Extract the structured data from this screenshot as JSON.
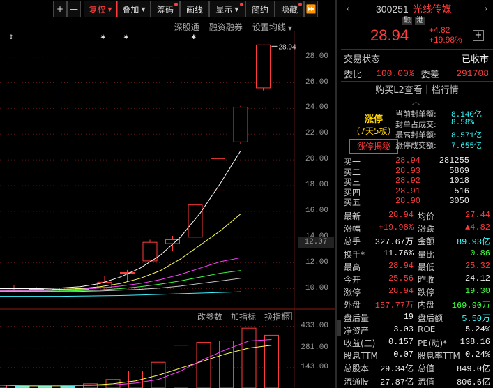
{
  "toolbar": {
    "plus": "+",
    "minus": "—",
    "fuquan": "复权",
    "diejia": "叠加",
    "chouma": "筹码",
    "huaxian": "画线",
    "xianshi": "显示",
    "jianyue": "简约",
    "yincang": "隐藏",
    "expand": "⏩"
  },
  "sublinks": [
    "深股通",
    "融资融券",
    "设置均线"
  ],
  "chart": {
    "y_ticks": [
      "28.00",
      "26.00",
      "24.00",
      "22.00",
      "20.00",
      "18.00",
      "16.00",
      "14.00",
      "12.00",
      "10.00"
    ],
    "current_price_tag": "12.07",
    "high_marker": "28.94",
    "vol_ticks": [
      "433.00",
      "281.00",
      "143.00"
    ],
    "vol_tools": [
      "改参数",
      "加指标",
      "换指标"
    ],
    "vol_close": "✕"
  },
  "chart_data": {
    "type": "candlestick",
    "y_range": [
      9,
      29.5
    ],
    "candles": [
      {
        "o": 9.9,
        "h": 10.3,
        "l": 9.75,
        "c": 9.9,
        "color": "red"
      },
      {
        "o": 9.9,
        "h": 10.1,
        "l": 9.8,
        "c": 9.95,
        "color": "cyan"
      },
      {
        "o": 9.95,
        "h": 10.05,
        "l": 9.85,
        "c": 9.95,
        "color": "cyan"
      },
      {
        "o": 10.0,
        "h": 10.1,
        "l": 9.8,
        "c": 9.9,
        "color": "cyan"
      },
      {
        "o": 10.1,
        "h": 11.0,
        "l": 9.9,
        "c": 10.5,
        "color": "red"
      },
      {
        "o": 11.25,
        "h": 11.45,
        "l": 10.55,
        "c": 11.2,
        "color": "red"
      },
      {
        "o": 12.15,
        "h": 13.8,
        "l": 12.1,
        "c": 13.6,
        "color": "red"
      },
      {
        "o": 13.5,
        "h": 14.1,
        "l": 12.9,
        "c": 13.8,
        "color": "red"
      },
      {
        "o": 14.0,
        "h": 16.5,
        "l": 14.0,
        "c": 16.5,
        "color": "red"
      },
      {
        "o": 17.6,
        "h": 20.15,
        "l": 17.5,
        "c": 20.1,
        "color": "red"
      },
      {
        "o": 21.4,
        "h": 24.2,
        "l": 21.2,
        "c": 24.1,
        "color": "red"
      },
      {
        "o": 25.6,
        "h": 28.94,
        "l": 25.4,
        "c": 28.94,
        "color": "red"
      }
    ],
    "ma_lines": [
      {
        "color": "#ffffff",
        "values": [
          10.0,
          10.0,
          10.0,
          10.05,
          10.15,
          10.4,
          10.9,
          11.6,
          12.6,
          14.0,
          15.9,
          18.2,
          20.7
        ]
      },
      {
        "color": "#ffff55",
        "values": [
          9.9,
          9.9,
          9.9,
          9.95,
          10.0,
          10.15,
          10.4,
          10.8,
          11.4,
          12.3,
          13.4,
          14.5,
          15.8
        ]
      },
      {
        "color": "#ff44ff",
        "values": [
          9.85,
          9.85,
          9.85,
          9.9,
          9.95,
          10.05,
          10.2,
          10.4,
          10.7,
          11.1,
          11.6,
          12.1,
          12.4
        ]
      },
      {
        "color": "#44ff44",
        "values": [
          9.8,
          9.8,
          9.8,
          9.82,
          9.85,
          9.9,
          10.0,
          10.15,
          10.35,
          10.6,
          10.9,
          11.2,
          11.4
        ]
      },
      {
        "color": "#cccccc",
        "values": [
          9.75,
          9.75,
          9.75,
          9.76,
          9.78,
          9.82,
          9.88,
          9.95,
          10.05,
          10.2,
          10.4,
          10.6,
          10.8
        ]
      },
      {
        "color": "#3ff3ff",
        "values": [
          9.4,
          9.4,
          9.4,
          9.4,
          9.42,
          9.44,
          9.46,
          9.5,
          9.55,
          9.6,
          9.65,
          9.7,
          9.75
        ]
      }
    ],
    "volume": [
      20,
      15,
      14,
      18,
      30,
      60,
      120,
      180,
      300,
      320,
      330,
      420,
      370
    ],
    "volume_colors": [
      "red",
      "cyan",
      "cyan",
      "cyan",
      "red",
      "red",
      "red",
      "red",
      "red",
      "red",
      "red",
      "red",
      "red"
    ],
    "volume_range": [
      0,
      460
    ],
    "vol_ma": [
      [
        20,
        15,
        15,
        16,
        20,
        30,
        50,
        90,
        140,
        190,
        240,
        280,
        300
      ],
      [
        20,
        18,
        17,
        17,
        18,
        22,
        35,
        60,
        120,
        200,
        270,
        330,
        340
      ]
    ]
  },
  "panel": {
    "code": "300251",
    "name": "光线传媒",
    "badge1": "融",
    "badge2": "港",
    "price": "28.94",
    "chg": "+4.82",
    "chg_pct": "+19.98%",
    "plus": "+",
    "trade_status_label": "交易状态",
    "trade_status_value": "已收市",
    "weibi_label": "委比",
    "weibi_value": "100.00%",
    "weicha_label": "委差",
    "weicha_value": "291708",
    "l2_link": "购买L2查看十档行情",
    "collapse_caret": "︿",
    "zt_title": "涨停",
    "zt_sub": "（7天5板）",
    "zt_btn": "涨停揭秘",
    "zt_info": [
      {
        "k": "当前封单额:",
        "v": "8.140亿"
      },
      {
        "k": "封单占成交:",
        "v": "8.58%"
      },
      {
        "k": "最高封单额:",
        "v": "8.571亿"
      },
      {
        "k": "涨停成交额:",
        "v": "7.655亿"
      }
    ],
    "bids": [
      {
        "k": "买一",
        "p": "28.94",
        "v": "281255"
      },
      {
        "k": "买二",
        "p": "28.93",
        "v": "5869"
      },
      {
        "k": "买三",
        "p": "28.92",
        "v": "1018"
      },
      {
        "k": "买四",
        "p": "28.91",
        "v": "516"
      },
      {
        "k": "买五",
        "p": "28.90",
        "v": "3050"
      }
    ],
    "quotes": [
      {
        "l1": "最新",
        "v1": "28.94",
        "c1": "red",
        "l2": "均价",
        "v2": "27.44",
        "c2": "red"
      },
      {
        "l1": "涨幅",
        "v1": "+19.98%",
        "c1": "red",
        "l2": "涨跌",
        "v2": "▲4.82",
        "c2": "red"
      },
      {
        "l1": "总手",
        "v1": "327.67万",
        "c1": "white",
        "l2": "金额",
        "v2": "89.93亿",
        "c2": "cyan"
      },
      {
        "l1": "换手*",
        "v1": "11.76%",
        "c1": "white",
        "l2": "量比",
        "v2": "0.86",
        "c2": "green"
      },
      {
        "l1": "最高",
        "v1": "28.94",
        "c1": "red",
        "l2": "最低",
        "v2": "25.32",
        "c2": "red"
      },
      {
        "l1": "今开",
        "v1": "25.56",
        "c1": "red",
        "l2": "昨收",
        "v2": "24.12",
        "c2": "white"
      },
      {
        "l1": "涨停",
        "v1": "28.94",
        "c1": "red",
        "l2": "跌停",
        "v2": "19.30",
        "c2": "green"
      },
      {
        "l1": "外盘",
        "v1": "157.77万",
        "c1": "red",
        "l2": "内盘",
        "v2": "169.90万",
        "c2": "green"
      },
      {
        "l1": "盘后量",
        "v1": "19",
        "c1": "white",
        "l2": "盘后额",
        "v2": "5.50万",
        "c2": "cyan"
      },
      {
        "l1": "净资产",
        "v1": "3.03",
        "c1": "white",
        "l2": "ROE",
        "v2": "5.24%",
        "c2": "white"
      },
      {
        "l1": "收益(三)",
        "v1": "0.157",
        "c1": "white",
        "l2": "PE(动)*",
        "v2": "138.16",
        "c2": "white"
      },
      {
        "l1": "股息TTM",
        "v1": "0.07",
        "c1": "white",
        "l2": "股息率TTM",
        "v2": "0.24%",
        "c2": "white"
      },
      {
        "l1": "总股本",
        "v1": "29.34亿",
        "c1": "white",
        "l2": "总值",
        "v2": "849.0亿",
        "c2": "white"
      },
      {
        "l1": "流通股",
        "v1": "27.87亿",
        "c1": "white",
        "l2": "流值",
        "v2": "806.6亿",
        "c2": "white"
      }
    ]
  }
}
